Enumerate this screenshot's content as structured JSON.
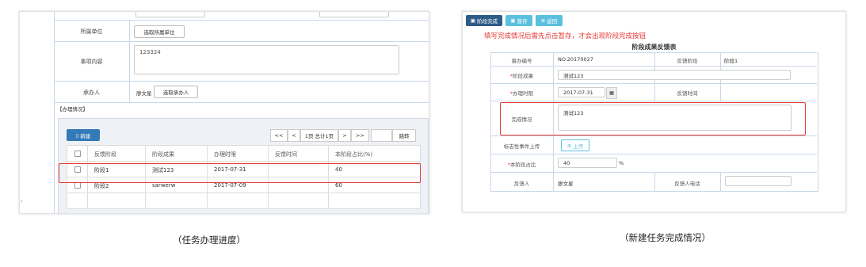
{
  "left": {
    "form": {
      "unit_label": "所属单位",
      "unit_button": "选取所属单位",
      "content_label": "事项内容",
      "content_value": "123324",
      "handler_label": "承办人",
      "handler_value": "廖文星",
      "handler_button": "选取承办人"
    },
    "section_title": "【办理情况】",
    "toolbar": {
      "new_label": "新建",
      "pager": {
        "first": "<<",
        "prev": "<",
        "info": "1页 总计1页",
        "next": ">",
        "last": ">>",
        "goto": "跳转"
      }
    },
    "table": {
      "headers": [
        "反馈阶段",
        "阶段成果",
        "办理时限",
        "反馈时间",
        "本阶段占比(%)"
      ],
      "rows": [
        [
          "阶段1",
          "测试123",
          "2017-07-31",
          "",
          "40"
        ],
        [
          "阶段2",
          "sarwerw",
          "2017-07-09",
          "",
          "60"
        ]
      ]
    },
    "caption": "（任务办理进度）"
  },
  "right": {
    "toolbar": {
      "complete": "阶段完成",
      "save": "暂存",
      "back": "返回"
    },
    "notice": "填写完成情况后需先点击暂存，才会出现阶段完成按钮",
    "notice_color": "#e53935",
    "form_title": "阶段成果反馈表",
    "fields": {
      "supervise_no_label": "督办编号",
      "supervise_no_value": "NO.20170027",
      "feedback_stage_label": "反馈阶段",
      "feedback_stage_value": "阶段1",
      "result_label": "阶段成果",
      "result_value": "测试123",
      "deadline_label": "办理时限",
      "deadline_value": "2017-07-31",
      "feedback_time_label": "反馈时间",
      "completion_label": "完成情况",
      "completion_value": "测试123",
      "attachment_label": "标志性事件上传",
      "upload_button": "上传",
      "ratio_label": "本阶段占比",
      "ratio_value": "40",
      "ratio_unit": "%",
      "feedback_person_label": "反馈人",
      "feedback_person_value": "廖文星",
      "feedback_phone_label": "反馈人电话"
    },
    "caption": "（新建任务完成情况）"
  },
  "colors": {
    "primary": "#337ab7",
    "info": "#5bc0de",
    "dark_button": "#2e5a86",
    "highlight": "#e53935"
  }
}
